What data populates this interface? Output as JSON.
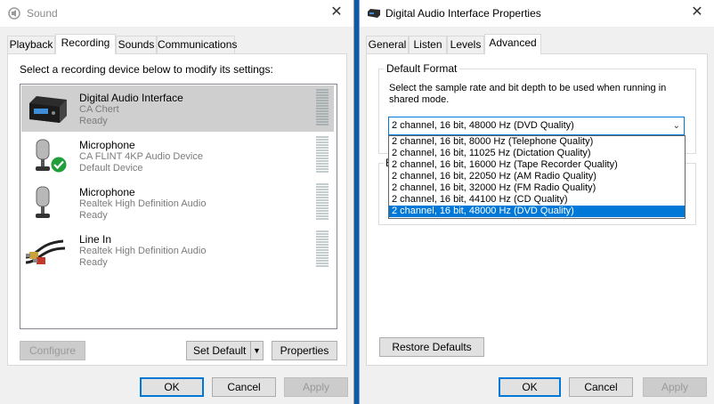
{
  "sound_window": {
    "title": "Sound",
    "tabs": [
      {
        "label": "Playback"
      },
      {
        "label": "Recording"
      },
      {
        "label": "Sounds"
      },
      {
        "label": "Communications"
      }
    ],
    "active_tab": "Recording",
    "instruction": "Select a recording device below to modify its settings:",
    "devices": [
      {
        "name": "Digital Audio Interface",
        "subtitle": "CA Chert",
        "status": "Ready",
        "icon": "audio-interface-icon",
        "selected": true
      },
      {
        "name": "Microphone",
        "subtitle": "CA FLINT 4KP Audio Device",
        "status": "Default Device",
        "icon": "microphone-icon",
        "default_badge": "green-check-icon"
      },
      {
        "name": "Microphone",
        "subtitle": "Realtek High Definition Audio",
        "status": "Ready",
        "icon": "microphone-icon"
      },
      {
        "name": "Line In",
        "subtitle": "Realtek High Definition Audio",
        "status": "Ready",
        "icon": "rca-cable-icon"
      }
    ],
    "buttons": {
      "configure": "Configure",
      "set_default": "Set Default",
      "properties": "Properties",
      "ok": "OK",
      "cancel": "Cancel",
      "apply": "Apply"
    }
  },
  "props_window": {
    "title": "Digital Audio Interface Properties",
    "tabs": [
      {
        "label": "General"
      },
      {
        "label": "Listen"
      },
      {
        "label": "Levels"
      },
      {
        "label": "Advanced"
      }
    ],
    "active_tab": "Advanced",
    "group_label": "Default Format",
    "group_hint": "E",
    "description": "Select the sample rate and bit depth to be used when running in shared mode.",
    "format_selected": "2 channel, 16 bit, 48000 Hz (DVD Quality)",
    "format_options": [
      "2 channel, 16 bit, 8000 Hz (Telephone Quality)",
      "2 channel, 16 bit, 11025 Hz (Dictation Quality)",
      "2 channel, 16 bit, 16000 Hz (Tape Recorder Quality)",
      "2 channel, 16 bit, 22050 Hz (AM Radio Quality)",
      "2 channel, 16 bit, 32000 Hz (FM Radio Quality)",
      "2 channel, 16 bit, 44100 Hz (CD Quality)",
      "2 channel, 16 bit, 48000 Hz (DVD Quality)"
    ],
    "highlighted_option_index": 6,
    "buttons": {
      "restore_defaults": "Restore Defaults",
      "ok": "OK",
      "cancel": "Cancel",
      "apply": "Apply"
    }
  },
  "colors": {
    "selection_blue": "#0078d7",
    "desktop_blue": "#0c5aa8",
    "default_check_green": "#1f9e3a"
  }
}
